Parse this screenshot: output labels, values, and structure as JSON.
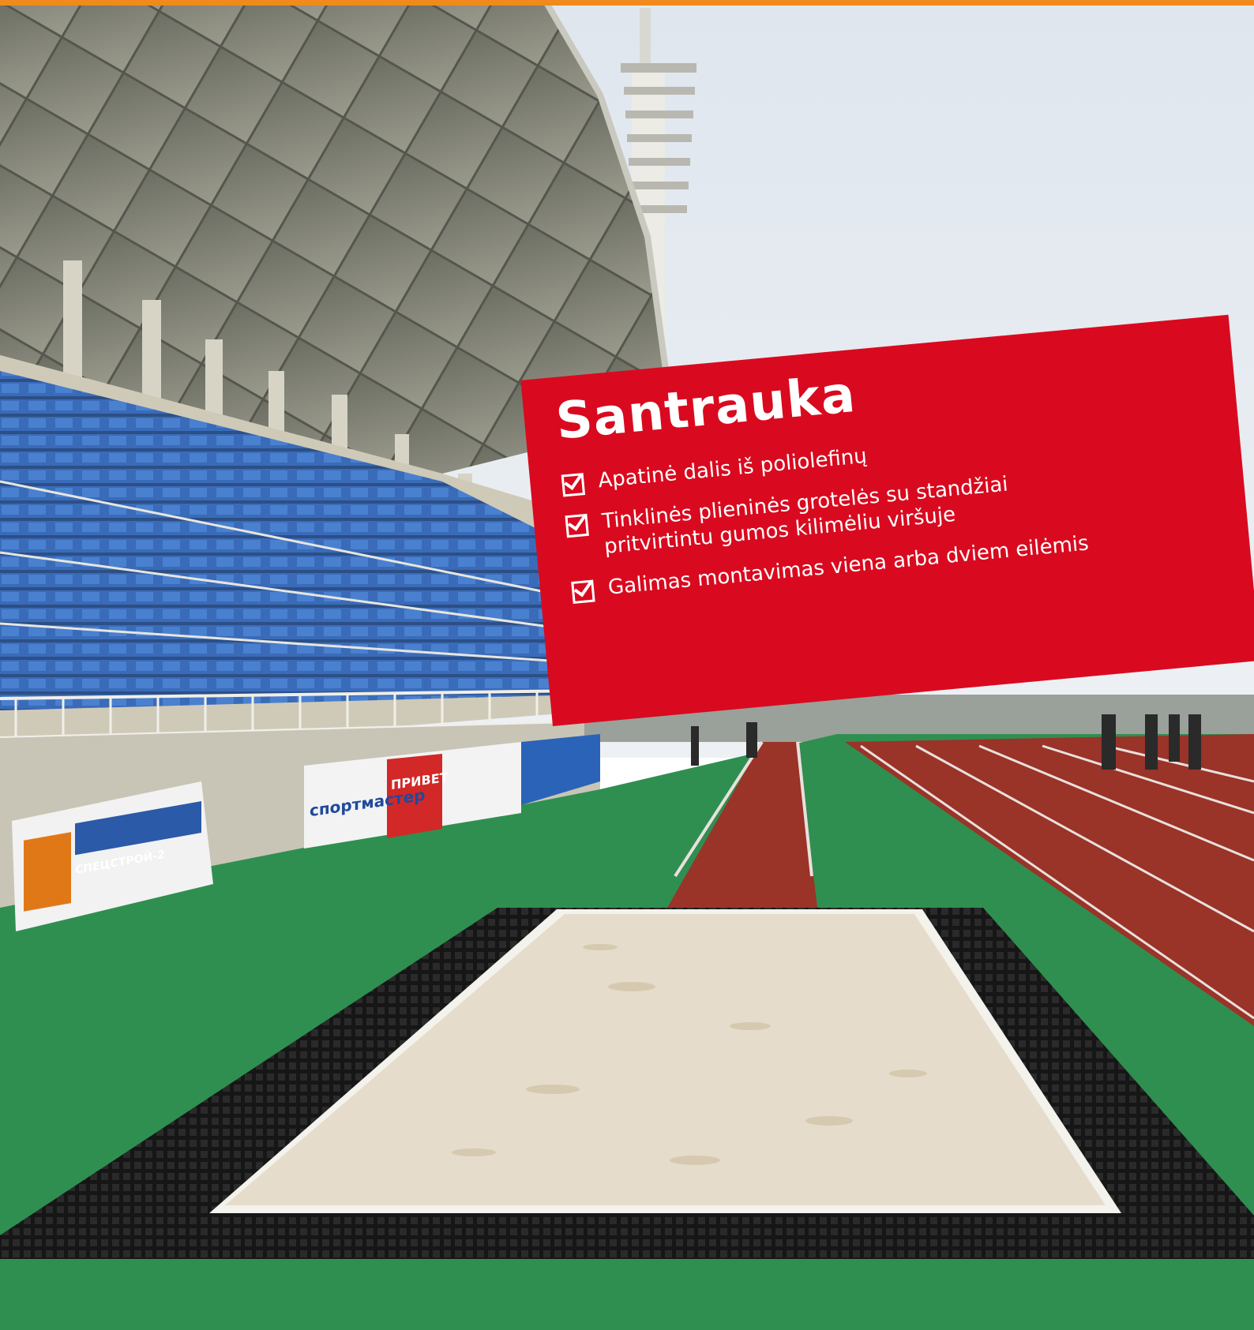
{
  "colors": {
    "accent_bar": "#f08a1c",
    "banner_red": "#d90a1f",
    "track_green": "#2f8f50",
    "running_track": "#9a3328",
    "seats_blue": "#2c63b8",
    "sand": "#e8dfd0",
    "grating_black": "#141414"
  },
  "summary": {
    "title": "Santrauka",
    "items": [
      {
        "text": "Apatinė dalis iš poliolefinų",
        "icon": "checkbox-checked-icon"
      },
      {
        "text": "Tinklinės plieninės grotelės su standžiai pritvirtintu gumos kilimėliu viršuje",
        "icon": "checkbox-checked-icon"
      },
      {
        "text": "Galimas montavimas viena arba dviem eilėmis",
        "icon": "checkbox-checked-icon"
      }
    ]
  },
  "banners": {
    "sponsor_1": "СПЕЦСТРОЙ-2",
    "sponsor_2": "спортмастер",
    "sponsor_3": "ПРИВЕТ"
  }
}
